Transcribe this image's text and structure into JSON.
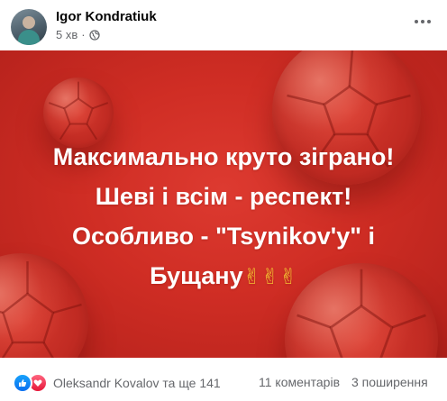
{
  "header": {
    "author_name": "Igor Kondratiuk",
    "time_ago": "5 хв",
    "separator": "·",
    "visibility_icon": "globe-icon",
    "more_icon": "more-options-icon"
  },
  "card": {
    "background_color": "#cf2d24",
    "text_color": "#ffffff",
    "lines": [
      "Максимально круто зіграно!",
      "Шеві і всім - респект!",
      "Особливо - \"Tsynikov'y\" і",
      "Бущану"
    ],
    "trailing_emoji": "✌✌✌"
  },
  "footer": {
    "reaction_icons": [
      "like-icon",
      "love-icon"
    ],
    "reactions_text": "Oleksandr Kovalov та ще 141",
    "comments_text": "11 коментарів",
    "shares_text": "3 поширення"
  },
  "colors": {
    "like_blue": "#1877f2",
    "love_red": "#f33e58",
    "secondary_text": "#65676b"
  }
}
